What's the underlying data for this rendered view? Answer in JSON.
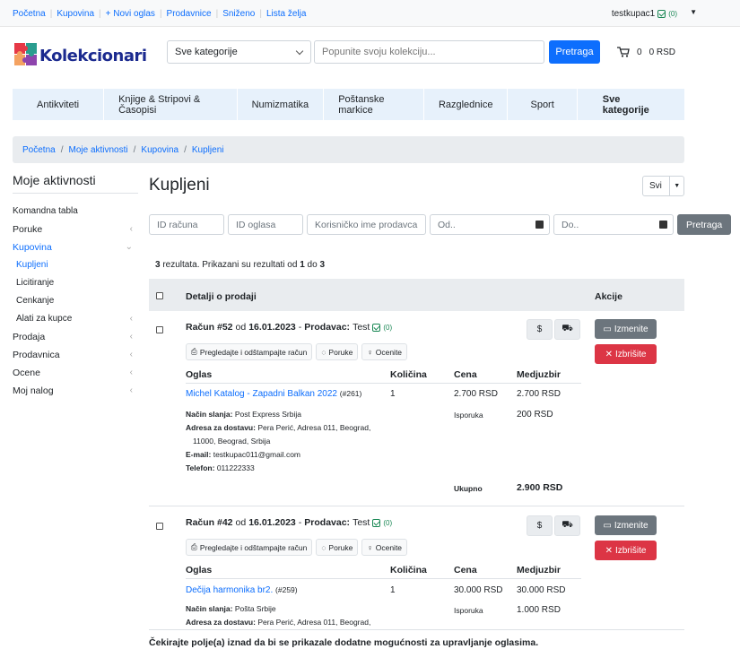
{
  "topbar": {
    "links": [
      "Početna",
      "Kupovina",
      "+ Novi oglas",
      "Prodavnice",
      "Sniženo",
      "Lista želja"
    ],
    "user": "testkupac1",
    "user_count": "(0)"
  },
  "header": {
    "logo_text": "Kolekcionari",
    "category_select": "Sve kategorije",
    "search_placeholder": "Popunite svoju kolekciju...",
    "search_button": "Pretraga",
    "cart_count": "0",
    "cart_total": "0 RSD"
  },
  "catnav": [
    "Antikviteti",
    "Knjige & Stripovi & Časopisi",
    "Numizmatika",
    "Poštanske markice",
    "Razglednice",
    "Sport",
    "Sve kategorije"
  ],
  "breadcrumb": [
    "Početna",
    "Moje aktivnosti",
    "Kupovina",
    "Kupljeni"
  ],
  "sidebar": {
    "title": "Moje aktivnosti",
    "items": [
      {
        "label": "Komandna tabla"
      },
      {
        "label": "Poruke"
      },
      {
        "label": "Kupovina"
      },
      {
        "label": "Kupljeni"
      },
      {
        "label": "Licitiranje"
      },
      {
        "label": "Cenkanje"
      },
      {
        "label": "Alati za kupce"
      },
      {
        "label": "Prodaja"
      },
      {
        "label": "Prodavnica"
      },
      {
        "label": "Ocene"
      },
      {
        "label": "Moj nalog"
      }
    ]
  },
  "main": {
    "title": "Kupljeni",
    "filter_select": "Svi",
    "filters": {
      "invoice_id": "ID računa",
      "ad_id": "ID oglasa",
      "seller": "Korisničko ime prodavca",
      "from": "Od..",
      "to": "Do..",
      "button": "Pretraga"
    },
    "results": {
      "count": "3",
      "text1": "rezultata. Prikazani su rezultati od",
      "from": "1",
      "text2": "do",
      "to": "3"
    },
    "table_headers": {
      "details": "Detalji o prodaji",
      "actions": "Akcije"
    },
    "footer_note": "Čekirajte polje(a) iznad da bi se prikazale dodatne mogućnosti za upravljanje oglasima."
  },
  "common": {
    "btn_print": "Pregledajte i odštampajte račun",
    "btn_messages": "Poruke",
    "btn_rate": "Ocenite",
    "btn_edit": "Izmenite",
    "btn_delete": "Izbrišite",
    "col_ad": "Oglas",
    "col_qty": "Količina",
    "col_price": "Cena",
    "col_subtotal": "Medjuzbir",
    "lbl_shipping": "Način slanja:",
    "lbl_address": "Adresa za dostavu:",
    "lbl_email": "E-mail:",
    "lbl_phone": "Telefon:",
    "lbl_delivery": "Isporuka",
    "lbl_total": "Ukupno",
    "of": "od",
    "seller_label": "Prodavac:"
  },
  "orders": [
    {
      "invoice": "Račun #52",
      "date": "16.01.2023",
      "seller": "Test",
      "seller_count": "(0)",
      "item_name": "Michel Katalog - Zapadni Balkan 2022",
      "item_id": "(#261)",
      "qty": "1",
      "price": "2.700 RSD",
      "subtotal": "2.700 RSD",
      "shipping_method": "Post Express Srbija",
      "address_line1": "Pera Perić, Adresa 011, Beograd,",
      "address_line2": "11000, Beograd, Srbija",
      "email": "testkupac011@gmail.com",
      "phone": "011222333",
      "delivery_cost": "200 RSD",
      "total": "2.900 RSD"
    },
    {
      "invoice": "Račun #42",
      "date": "16.01.2023",
      "seller": "Test",
      "seller_count": "(0)",
      "item_name": "Dečija harmonika br2.",
      "item_id": "(#259)",
      "qty": "1",
      "price": "30.000 RSD",
      "subtotal": "30.000 RSD",
      "shipping_method": "Pošta Srbije",
      "address_line1": "Pera Perić, Adresa 011, Beograd,",
      "delivery_cost": "1.000 RSD"
    }
  ]
}
